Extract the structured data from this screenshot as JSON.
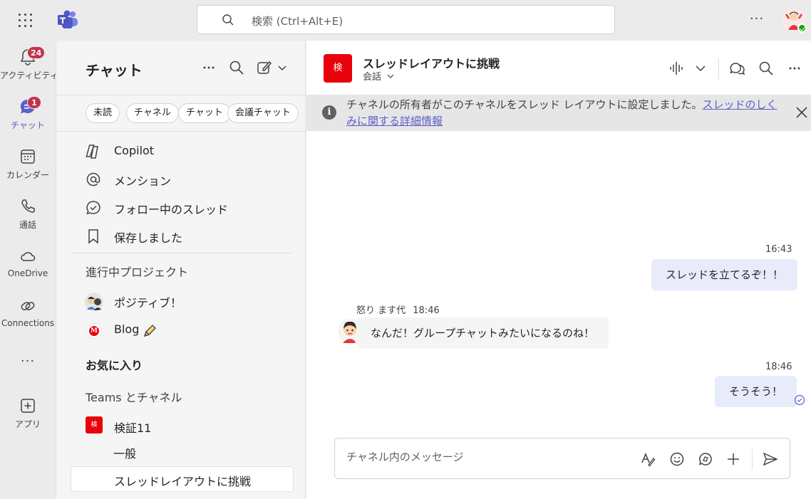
{
  "topbar": {
    "search_placeholder": "検索 (Ctrl+Alt+E)",
    "more_label": "···"
  },
  "rail": {
    "items": [
      {
        "label": "アクティビティ",
        "badge": "24",
        "icon": "bell-icon"
      },
      {
        "label": "チャット",
        "badge": "1",
        "icon": "chat-icon",
        "active": true
      },
      {
        "label": "カレンダー",
        "icon": "calendar-icon"
      },
      {
        "label": "通話",
        "icon": "phone-icon"
      },
      {
        "label": "OneDrive",
        "icon": "cloud-icon"
      },
      {
        "label": "Connections",
        "icon": "connections-icon"
      },
      {
        "label": "···",
        "icon": "more-icon"
      },
      {
        "label": "アプリ",
        "icon": "add-app-icon"
      }
    ]
  },
  "chatlist": {
    "title": "チャット",
    "filters": [
      "未読",
      "チャネル",
      "チャット",
      "会議チャット"
    ],
    "nav": [
      {
        "label": "Copilot",
        "icon": "copilot-icon"
      },
      {
        "label": "メンション",
        "icon": "at-icon"
      },
      {
        "label": "フォロー中のスレッド",
        "icon": "followed-threads-icon"
      },
      {
        "label": "保存しました",
        "icon": "bookmark-icon"
      }
    ],
    "section_projects": "進行中プロジェクト",
    "projects": [
      {
        "label": "ポジティブ！"
      },
      {
        "label": "Blog",
        "avatar_text": "M"
      }
    ],
    "section_favorites": "お気に入り",
    "section_teams": "Teams とチャネル",
    "team": {
      "name": "検証11",
      "icon_text": "検"
    },
    "channels": [
      "一般",
      "スレッドレイアウトに挑戦"
    ]
  },
  "channel": {
    "icon_text": "検",
    "title": "スレッドレイアウトに挑戦",
    "subtitle": "会話",
    "banner_text": "チャネルの所有者がこのチャネルをスレッド レイアウトに設定しました。",
    "banner_link": "スレッドのしくみに関する詳細情報"
  },
  "messages": [
    {
      "time": "16:43",
      "text": "スレッドを立てるぞ！！",
      "mine": true
    },
    {
      "sender": "怒り ます代",
      "time": "18:46",
      "text": "なんだ！グループチャットみたいになるのね！",
      "mine": false
    },
    {
      "time": "18:46",
      "text": "そうそう！",
      "mine": true
    }
  ],
  "composer": {
    "placeholder": "チャネル内のメッセージ"
  },
  "colors": {
    "accent": "#5b5fc7",
    "badge": "#c4314b",
    "team_red": "#e8000b",
    "presence": "#13a10e"
  }
}
